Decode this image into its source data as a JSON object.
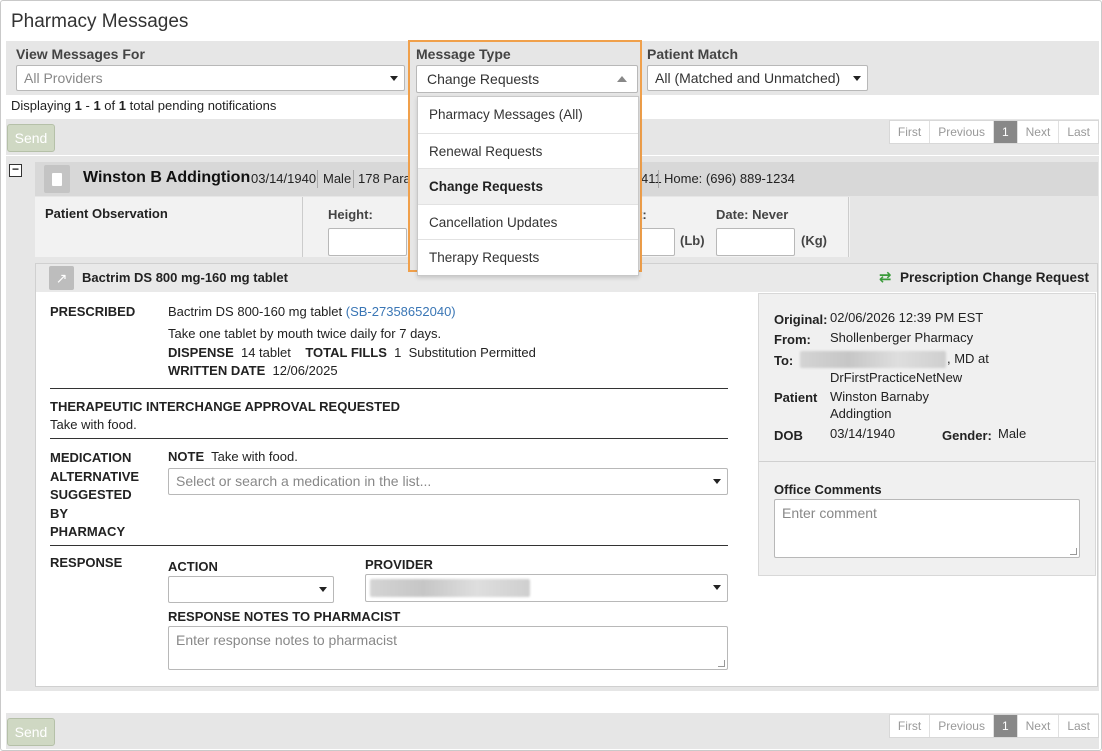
{
  "page": {
    "title": "Pharmacy Messages"
  },
  "filters": {
    "view_for": {
      "label": "View Messages For",
      "value": "All Providers"
    },
    "message_type": {
      "label": "Message Type",
      "value": "Change Requests",
      "options": [
        "Pharmacy Messages (All)",
        "Renewal Requests",
        "Change Requests",
        "Cancellation Updates",
        "Therapy Requests"
      ]
    },
    "patient_match": {
      "label": "Patient Match",
      "value": "All (Matched and Unmatched)"
    }
  },
  "display": {
    "prefix": "Displaying",
    "from": "1",
    "sep": "-",
    "to": "1",
    "of": "of",
    "total": "1",
    "suffix": "total pending notifications"
  },
  "toolbar": {
    "send_label": "Send",
    "pager": [
      "First",
      "Previous",
      "1",
      "Next",
      "Last"
    ]
  },
  "patient": {
    "name": "Winston B Addingtion",
    "dob": "03/14/1940",
    "sex": "Male",
    "address_partial": "178 Para",
    "phone_partial": "411",
    "home_phone": "Home: (696) 889-1234"
  },
  "observation": {
    "title": "Patient Observation",
    "height_label": "Height:",
    "weight_label_partial": "t:",
    "lb_unit": "(Lb)",
    "date_label": "Date: Never",
    "kg_unit": "(Kg)",
    "open_paren": "("
  },
  "rx": {
    "title": "Bactrim DS 800 mg-160 mg tablet",
    "request_type": "Prescription Change Request",
    "prescribed_label": "PRESCRIBED",
    "drug": "Bactrim DS 800-160 mg tablet",
    "drug_code": "(SB-27358652040)",
    "sig": "Take one tablet by mouth twice daily for 7 days.",
    "dispense_label": "DISPENSE",
    "dispense_value": "14 tablet",
    "fills_label": "TOTAL FILLS",
    "fills_value": "1",
    "substitution": "Substitution Permitted",
    "written_label": "WRITTEN DATE",
    "written_value": "12/06/2025",
    "interchange_label": "THERAPEUTIC INTERCHANGE APPROVAL REQUESTED",
    "interchange_note": "Take with food.",
    "alt_label": [
      "MEDICATION",
      "ALTERNATIVE",
      "SUGGESTED",
      "BY",
      "PHARMACY"
    ],
    "note_label": "NOTE",
    "note_value": "Take with food.",
    "med_search_placeholder": "Select or search a medication in the list...",
    "response_label": "RESPONSE",
    "action_label": "ACTION",
    "provider_label": "PROVIDER",
    "notes_label": "RESPONSE NOTES TO PHARMACIST",
    "notes_placeholder": "Enter response notes to pharmacist"
  },
  "details": {
    "original_label": "Original:",
    "original_value": "02/06/2026 12:39 PM EST",
    "from_label": "From:",
    "from_value": "Shollenberger Pharmacy",
    "to_label": "To:",
    "to_suffix": ", MD at",
    "to_practice": "DrFirstPracticeNetNew",
    "patient_label": "Patient",
    "patient_value_1": "Winston Barnaby",
    "patient_value_2": "Addingtion",
    "dob_label": "DOB",
    "dob_value": "03/14/1940",
    "gender_label": "Gender:",
    "gender_value": "Male",
    "comments_label": "Office Comments",
    "comments_placeholder": "Enter comment"
  },
  "colors": {
    "highlight": "#f0a04b",
    "link": "#3a76b5",
    "send_disabled": "#cfd8c3",
    "active_page": "#888888",
    "arrows": "#3a9a3a"
  }
}
